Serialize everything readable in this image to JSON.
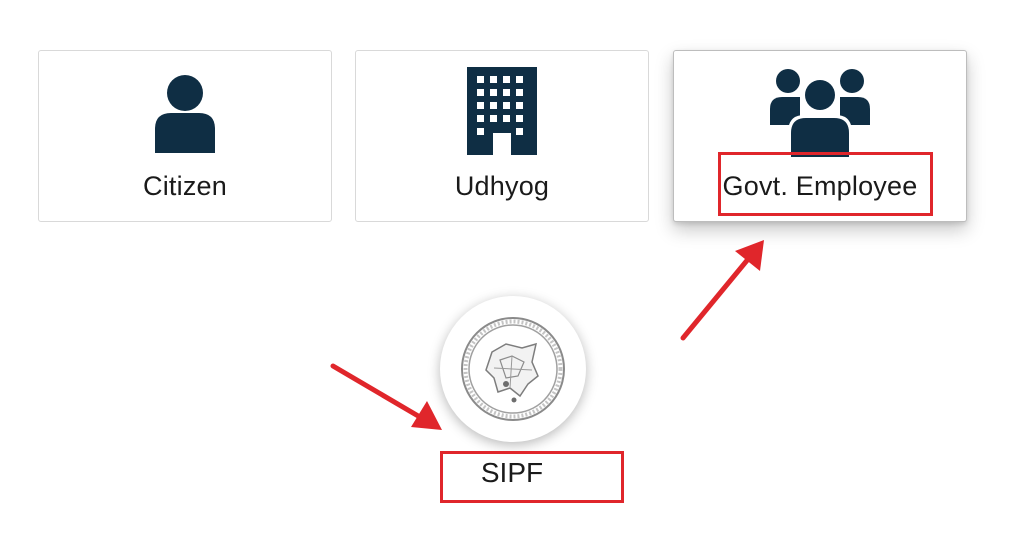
{
  "cards": [
    {
      "label": "Citizen",
      "icon": "person-icon"
    },
    {
      "label": "Udhyog",
      "icon": "building-icon"
    },
    {
      "label": "Govt. Employee",
      "icon": "group-icon"
    }
  ],
  "portal": {
    "label": "SIPF",
    "logo": "sipf-emblem-icon"
  },
  "colors": {
    "icon": "#0f2e44",
    "annotation": "#e0262b"
  }
}
